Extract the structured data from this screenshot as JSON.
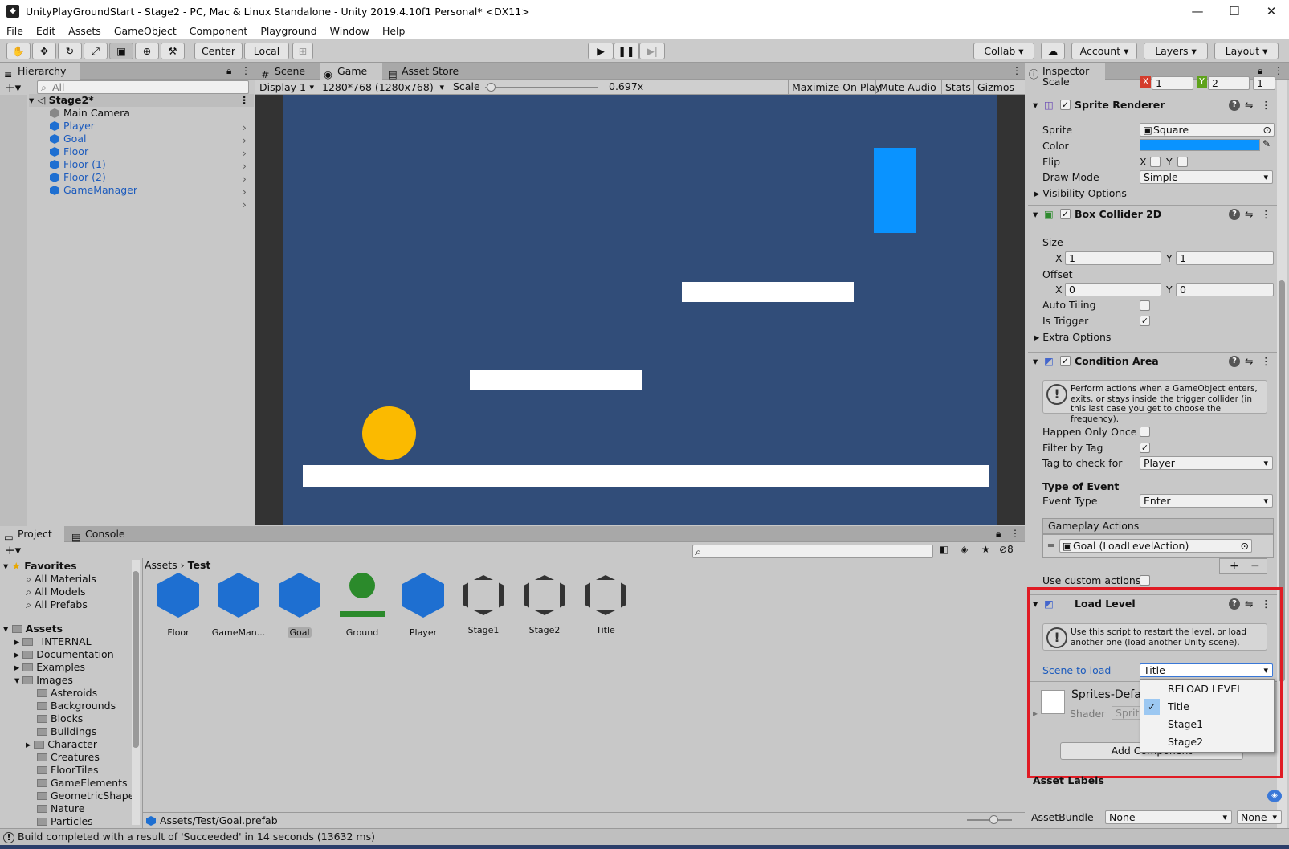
{
  "window": {
    "title": "UnityPlayGroundStart - Stage2 - PC, Mac & Linux Standalone - Unity 2019.4.10f1 Personal* <DX11>",
    "minimize": "—",
    "maximize": "☐",
    "close": "✕"
  },
  "menu": [
    "File",
    "Edit",
    "Assets",
    "GameObject",
    "Component",
    "Playground",
    "Window",
    "Help"
  ],
  "toolbar": {
    "pivot": "Center",
    "space": "Local",
    "collab": "Collab",
    "account": "Account",
    "layers": "Layers",
    "layout": "Layout"
  },
  "hierarchy": {
    "tab": "Hierarchy",
    "search_placeholder": "All",
    "scene": "Stage2*",
    "items": [
      "Main Camera",
      "Player",
      "Goal",
      "Floor",
      "Floor (1)",
      "Floor (2)",
      "GameManager"
    ]
  },
  "game_view": {
    "tabs": [
      "Scene",
      "Game",
      "Asset Store"
    ],
    "display": "Display 1",
    "resolution": "1280*768 (1280x768)",
    "scale_label": "Scale",
    "scale_value": "0.697x",
    "scale_fraction": 0.05,
    "buttons": [
      "Maximize On Play",
      "Mute Audio",
      "Stats",
      "Gizmos"
    ]
  },
  "inspector": {
    "tab": "Inspector",
    "scale": {
      "label": "Scale",
      "x_label": "X",
      "x": "1",
      "y_label": "Y",
      "y": "2",
      "z": "1"
    },
    "sprite_renderer": {
      "title": "Sprite Renderer",
      "sprite_label": "Sprite",
      "sprite": "Square",
      "color_label": "Color",
      "color": "#0a93ff",
      "flip_label": "Flip",
      "flip_x": "X",
      "flip_y": "Y",
      "draw_mode_label": "Draw Mode",
      "draw_mode": "Simple",
      "visibility": "Visibility Options"
    },
    "box_collider": {
      "title": "Box Collider 2D",
      "size_label": "Size",
      "size_x": "1",
      "size_y": "1",
      "offset_label": "Offset",
      "offset_x": "0",
      "offset_y": "0",
      "x_label": "X",
      "y_label": "Y",
      "auto_tiling": "Auto Tiling",
      "is_trigger": "Is Trigger",
      "extra": "Extra Options"
    },
    "condition_area": {
      "title": "Condition Area",
      "info": "Perform actions when a GameObject enters, exits, or stays inside the trigger collider (in this last case you get to choose the frequency).",
      "happen_once": "Happen Only Once",
      "filter_tag": "Filter by Tag",
      "tag_label": "Tag to check for",
      "tag": "Player",
      "type_header": "Type of Event",
      "event_label": "Event Type",
      "event": "Enter",
      "actions_header": "Gameplay Actions",
      "action": "Goal (LoadLevelAction)",
      "custom": "Use custom actions"
    },
    "load_level": {
      "title": "Load Level",
      "info": "Use this script to restart the level, or load another one (load another Unity scene).",
      "scene_label": "Scene to load",
      "scene": "Title",
      "options": [
        "RELOAD LEVEL",
        "Title",
        "Stage1",
        "Stage2"
      ],
      "selected_option": "Title"
    },
    "material": {
      "name": "Sprites-Defau",
      "shader_label": "Shader",
      "shader": "Sprite"
    },
    "add_component": "Add Component",
    "asset_labels": "Asset Labels",
    "asset_bundle_label": "AssetBundle",
    "asset_bundle": "None",
    "asset_variant": "None"
  },
  "project": {
    "tabs": [
      "Project",
      "Console"
    ],
    "hidden_count": "8",
    "favorites_label": "Favorites",
    "favorites": [
      "All Materials",
      "All Models",
      "All Prefabs"
    ],
    "assets_label": "Assets",
    "tree": [
      "_INTERNAL_",
      "Documentation",
      "Examples",
      "Images"
    ],
    "image_folders": [
      "Asteroids",
      "Backgrounds",
      "Blocks",
      "Buildings",
      "Character",
      "Creatures",
      "FloorTiles",
      "GameElements",
      "GeometricShapes",
      "Nature",
      "Particles"
    ],
    "breadcrumb": [
      "Assets",
      "Test"
    ],
    "assets": [
      "Floor",
      "GameMan...",
      "Goal",
      "Ground",
      "Player",
      "Stage1",
      "Stage2",
      "Title"
    ],
    "path": "Assets/Test/Goal.prefab"
  },
  "status": "Build completed with a result of 'Succeeded' in 14 seconds (13632 ms)"
}
